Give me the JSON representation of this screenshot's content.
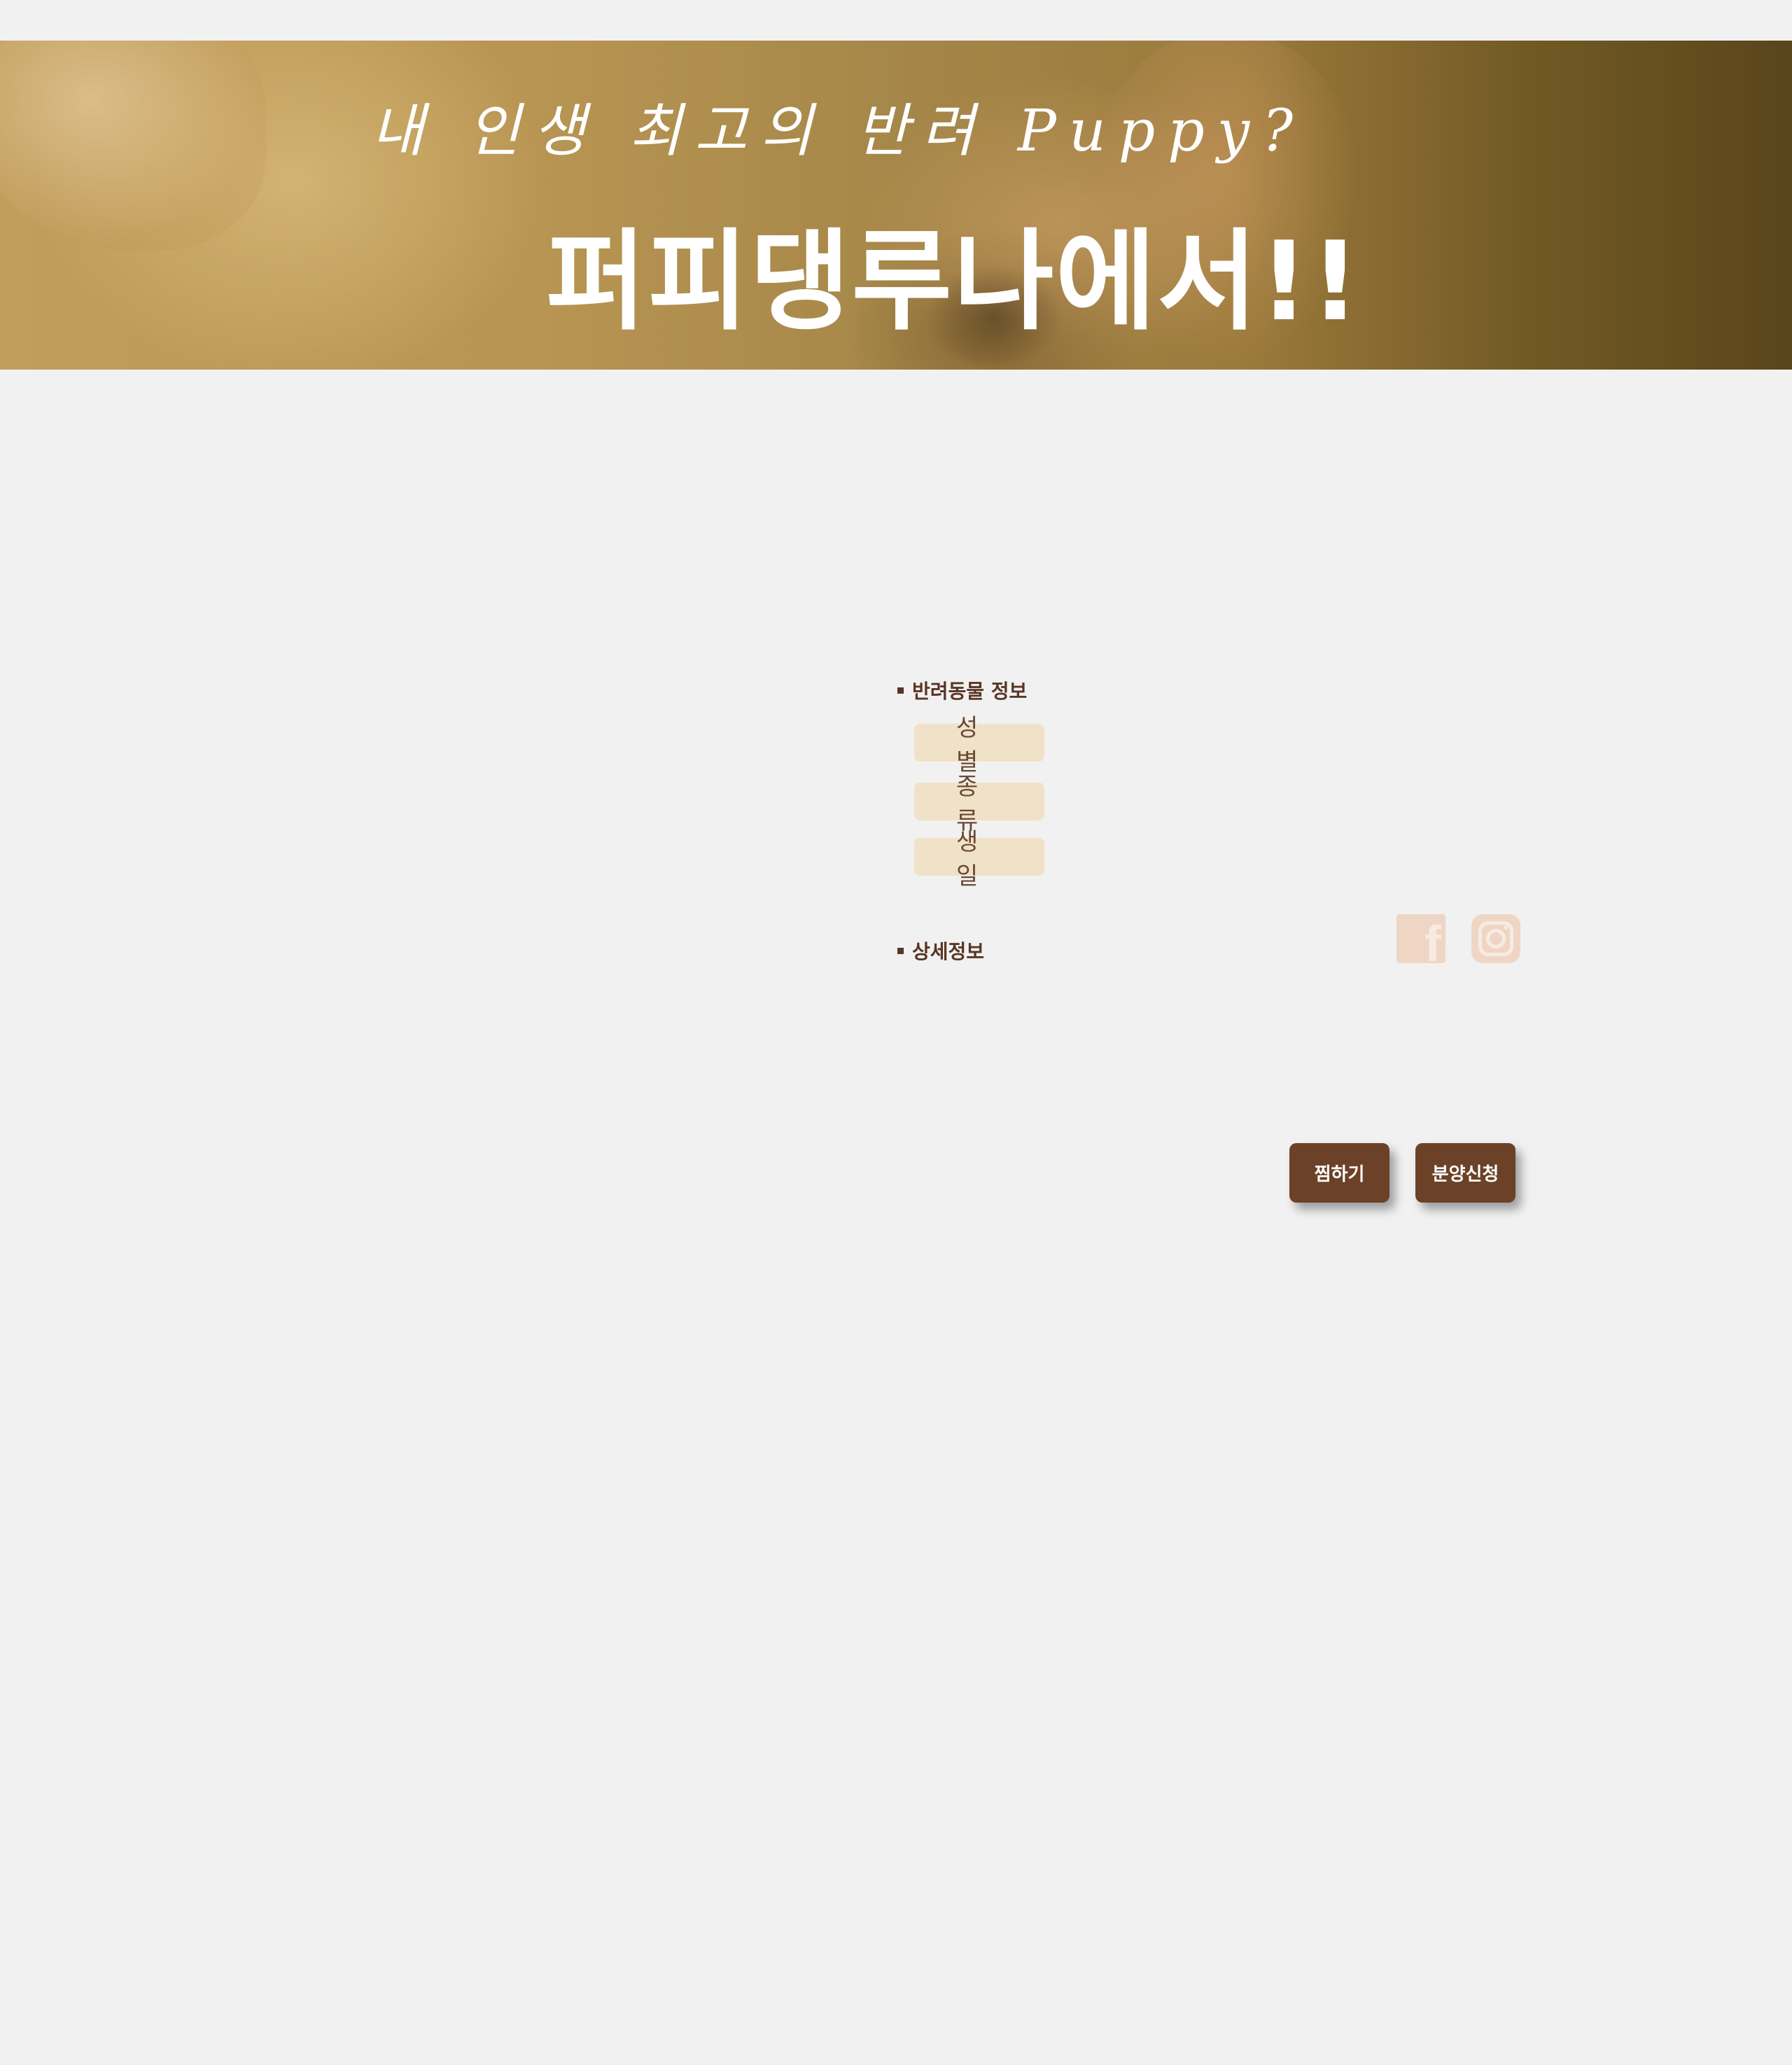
{
  "banner": {
    "tagline": "내 인생 최고의 반려 Puppy?",
    "headline": "퍼피댕루나에서!!"
  },
  "pet_info": {
    "title": "반려동물 정보",
    "labels": [
      "성별",
      "종류",
      "생일"
    ]
  },
  "details": {
    "title": "상세정보"
  },
  "social": {
    "facebook": "facebook-icon",
    "instagram": "instagram-icon"
  },
  "actions": {
    "wishlist_label": "찜하기",
    "adopt_label": "분양신청"
  }
}
